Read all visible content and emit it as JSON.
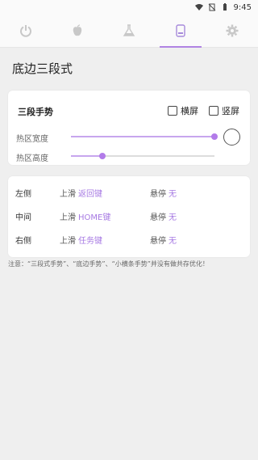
{
  "status": {
    "time": "9:45",
    "icons": [
      "wifi-icon",
      "no-sim-icon",
      "battery-icon"
    ]
  },
  "tabs": [
    {
      "icon": "power-icon"
    },
    {
      "icon": "apple-icon"
    },
    {
      "icon": "flask-icon"
    },
    {
      "icon": "phone-icon",
      "active": true
    },
    {
      "icon": "gear-icon"
    }
  ],
  "page": {
    "title": "底边三段式"
  },
  "gesture": {
    "heading": "三段手势",
    "landscape_label": "横屏",
    "portrait_label": "竖屏",
    "width_label": "热区宽度",
    "height_label": "热区高度",
    "width_value": 1.0,
    "height_value": 0.22
  },
  "actions": {
    "rows": [
      {
        "side": "左侧",
        "swipe_label": "上滑",
        "swipe_value": "返回键",
        "hover_label": "悬停",
        "hover_value": "无"
      },
      {
        "side": "中间",
        "swipe_label": "上滑",
        "swipe_value": "HOME键",
        "hover_label": "悬停",
        "hover_value": "无"
      },
      {
        "side": "右侧",
        "swipe_label": "上滑",
        "swipe_value": "任务键",
        "hover_label": "悬停",
        "hover_value": "无"
      }
    ]
  },
  "note": "注意：“三段式手势”、“底边手势”、“小横条手势”并没有做共存优化！"
}
